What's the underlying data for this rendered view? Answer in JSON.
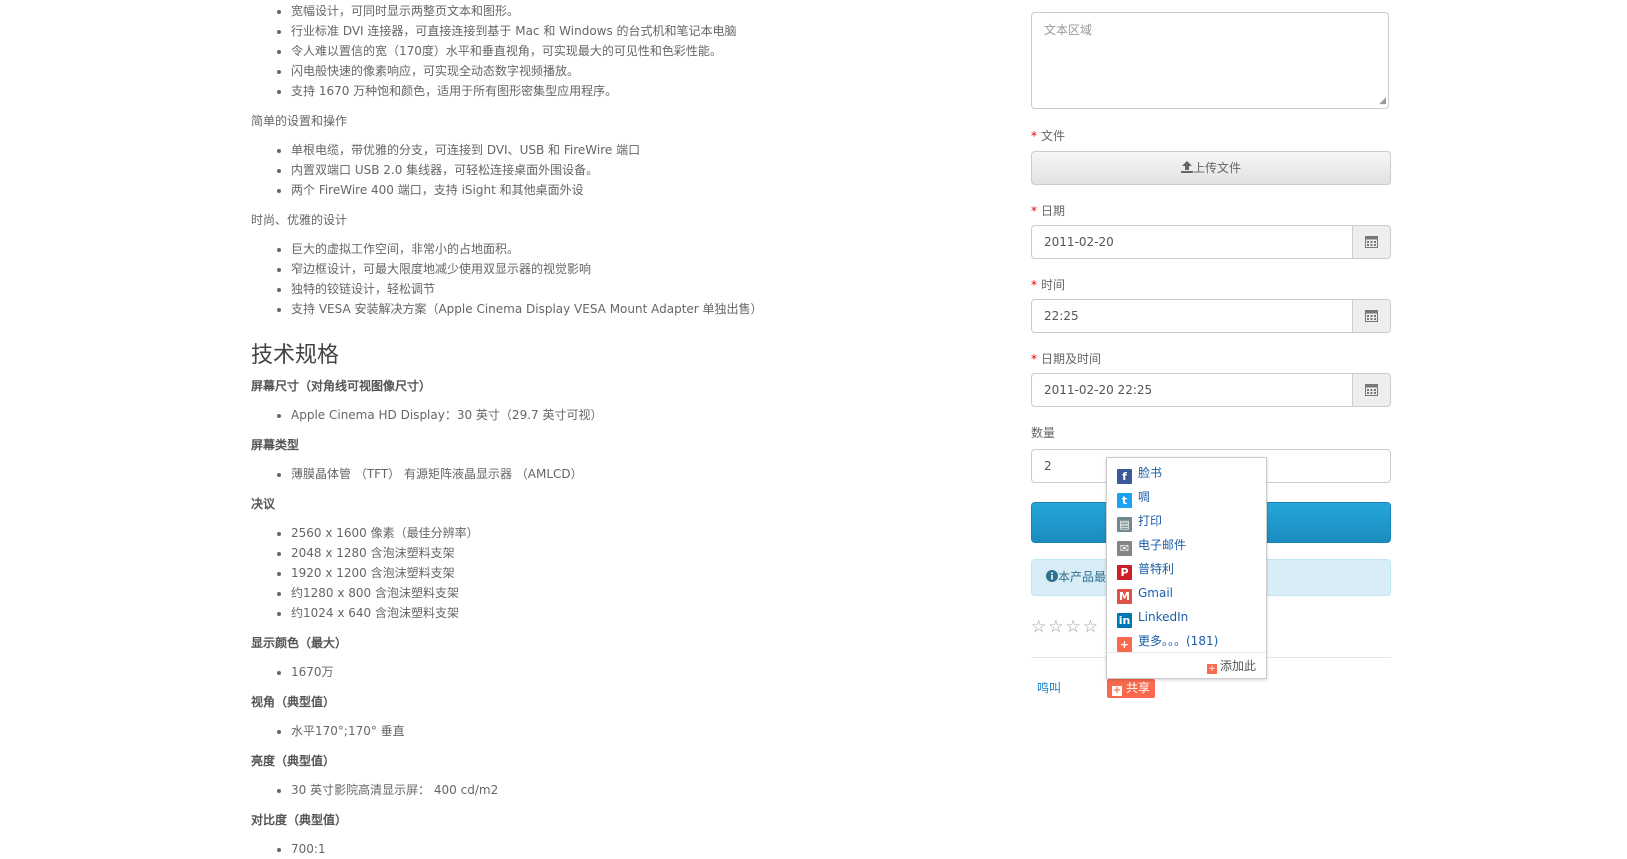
{
  "left": {
    "bullets_top": [
      "宽幅设计，可同时显示两整页文本和图形。",
      "行业标准 DVI 连接器，可直接连接到基于 Mac 和 Windows 的台式机和笔记本电脑",
      "令人难以置信的宽（170度）水平和垂直视角，可实现最大的可见性和色彩性能。",
      "闪电般快速的像素响应，可实现全动态数字视频播放。",
      "支持 1670 万种饱和颜色，适用于所有图形密集型应用程序。"
    ],
    "setup_heading": "简单的设置和操作",
    "setup_bullets": [
      "单根电缆，带优雅的分支，可连接到 DVI、USB 和 FireWire 端口",
      "内置双端口 USB 2.0 集线器，可轻松连接桌面外围设备。",
      "两个 FireWire 400 端口，支持 iSight 和其他桌面外设"
    ],
    "design_heading": "时尚、优雅的设计",
    "design_bullets": [
      "巨大的虚拟工作空间，非常小的占地面积。",
      "窄边框设计，可最大限度地减少使用双显示器的视觉影响",
      "独特的铰链设计，轻松调节",
      "支持 VESA 安装解决方案（Apple Cinema Display VESA Mount Adapter 单独出售）"
    ],
    "specs_title": "技术规格",
    "specs": [
      {
        "label": "屏幕尺寸（对角线可视图像尺寸）",
        "items": [
          "Apple Cinema HD Display：30 英寸（29.7 英寸可视）"
        ]
      },
      {
        "label": "屏幕类型",
        "items": [
          "薄膜晶体管 （TFT） 有源矩阵液晶显示器 （AMLCD）"
        ]
      },
      {
        "label": "决议",
        "items": [
          "2560 x 1600 像素（最佳分辨率）",
          "2048 x 1280 含泡沫塑料支架",
          "1920 x 1200 含泡沫塑料支架",
          "约1280 x 800 含泡沫塑料支架",
          "约1024 x 640 含泡沫塑料支架"
        ]
      },
      {
        "label": "显示颜色（最大）",
        "items": [
          "1670万"
        ]
      },
      {
        "label": "视角（典型值）",
        "items": [
          "水平170°;170° 垂直"
        ]
      },
      {
        "label": "亮度（典型值）",
        "items": [
          "30 英寸影院高清显示屏： 400 cd/m2"
        ]
      },
      {
        "label": "对比度（典型值）",
        "items": [
          "700:1"
        ]
      }
    ]
  },
  "form": {
    "textarea_placeholder": "文本区域",
    "file_label": "文件",
    "upload_button": "上传文件",
    "date_label": "日期",
    "date_value": "2011-02-20",
    "time_label": "时间",
    "time_value": "22:25",
    "datetime_label": "日期及时间",
    "datetime_value": "2011-02-20 22:25",
    "qty_label": "数量",
    "qty_value": "2",
    "alert_text": "本产品最",
    "required_mark": "*"
  },
  "social": {
    "tweet": "鸣叫",
    "share": "共享"
  },
  "share_popup": {
    "items": [
      {
        "label": "脸书",
        "icon": "facebook-icon",
        "color": "#3b5998"
      },
      {
        "label": "啁",
        "icon": "twitter-icon",
        "color": "#1da1f2"
      },
      {
        "label": "打印",
        "icon": "print-icon",
        "color": "#738a8d"
      },
      {
        "label": "电子邮件",
        "icon": "email-icon",
        "color": "#848484"
      },
      {
        "label": "普特利",
        "icon": "pinterest-icon",
        "color": "#cb2027"
      },
      {
        "label": "Gmail",
        "icon": "gmail-icon",
        "color": "#dd5347"
      },
      {
        "label": "LinkedIn",
        "icon": "linkedin-icon",
        "color": "#0077b5"
      },
      {
        "label": "更多。。。(181)",
        "icon": "more-icon",
        "color": "#f8694d"
      }
    ],
    "add_this": "添加此"
  }
}
